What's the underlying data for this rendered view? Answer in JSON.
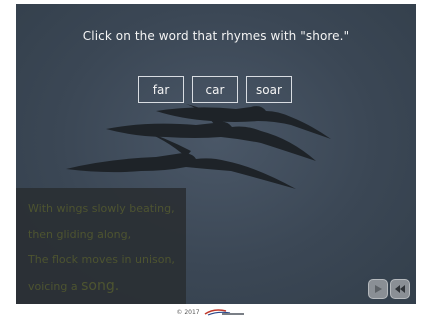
{
  "prompt": "Click on the word that rhymes with \"shore.\"",
  "choices": [
    "far",
    "car",
    "soar"
  ],
  "poem": {
    "line1": "With wings slowly beating,",
    "line2": "then gliding along,",
    "line3": "The flock moves in unison,",
    "line4_prefix": "voicing a",
    "line4_big": "song."
  },
  "footer": {
    "copyright": "© 2017"
  },
  "colors": {
    "stage_bg": "#3b4755",
    "poem_text": "#4f552f",
    "choice_border": "#d9dde2"
  },
  "icons": {
    "play": "play-icon",
    "rewind": "rewind-icon",
    "logo": "logo-icon"
  }
}
